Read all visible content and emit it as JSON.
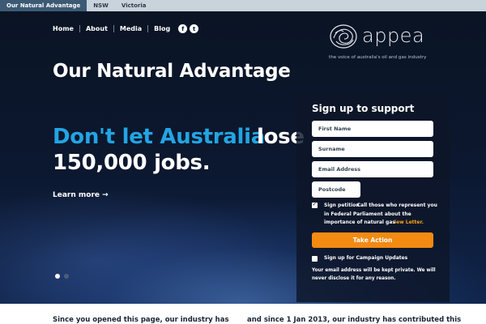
{
  "topbar": {
    "tabs": [
      {
        "label": "Our Natural Advantage",
        "active": true
      },
      {
        "label": "NSW",
        "active": false
      },
      {
        "label": "Victoria",
        "active": false
      }
    ]
  },
  "nav": {
    "links": [
      {
        "label": "Home"
      },
      {
        "label": "About"
      },
      {
        "label": "Media"
      },
      {
        "label": "Blog"
      }
    ],
    "social": {
      "facebook": "f",
      "twitter": "t"
    }
  },
  "logo": {
    "wordmark": "appea",
    "tagline": "the voice of australia's oil and gas industry"
  },
  "hero": {
    "title": "Our Natural Advantage",
    "slogan_blue": "Don't let Australia",
    "slogan_white_1": "lose",
    "slogan_white_2": "150,000 jobs.",
    "learn_more": "Learn more →",
    "slides": [
      {
        "active": true
      },
      {
        "active": false
      }
    ]
  },
  "form": {
    "heading": "Sign up to support",
    "first_name_placeholder": "First Name",
    "surname_placeholder": "Surname",
    "email_placeholder": "Email Address",
    "postcode_placeholder": "Postcode",
    "petition_checked": true,
    "petition_text_1": "Sign petition",
    "petition_text_2": "Call those who represent you in Federal Parliament about the importance of natural gas",
    "petition_link": "iew Letter.",
    "submit_label": "Take Action",
    "updates_checked": false,
    "updates_label": "Sign up for Campaign Updates",
    "privacy": "Your email address will be kept private. We will never disclose it for any reason."
  },
  "bottom": {
    "left": "Since you opened this page, our industry has",
    "right": "and since 1 Jan 2013, our industry has contributed this"
  },
  "colors": {
    "accent_blue": "#22a5e3",
    "cta_orange": "#f38a12",
    "topbar_active": "#3c5a74"
  }
}
